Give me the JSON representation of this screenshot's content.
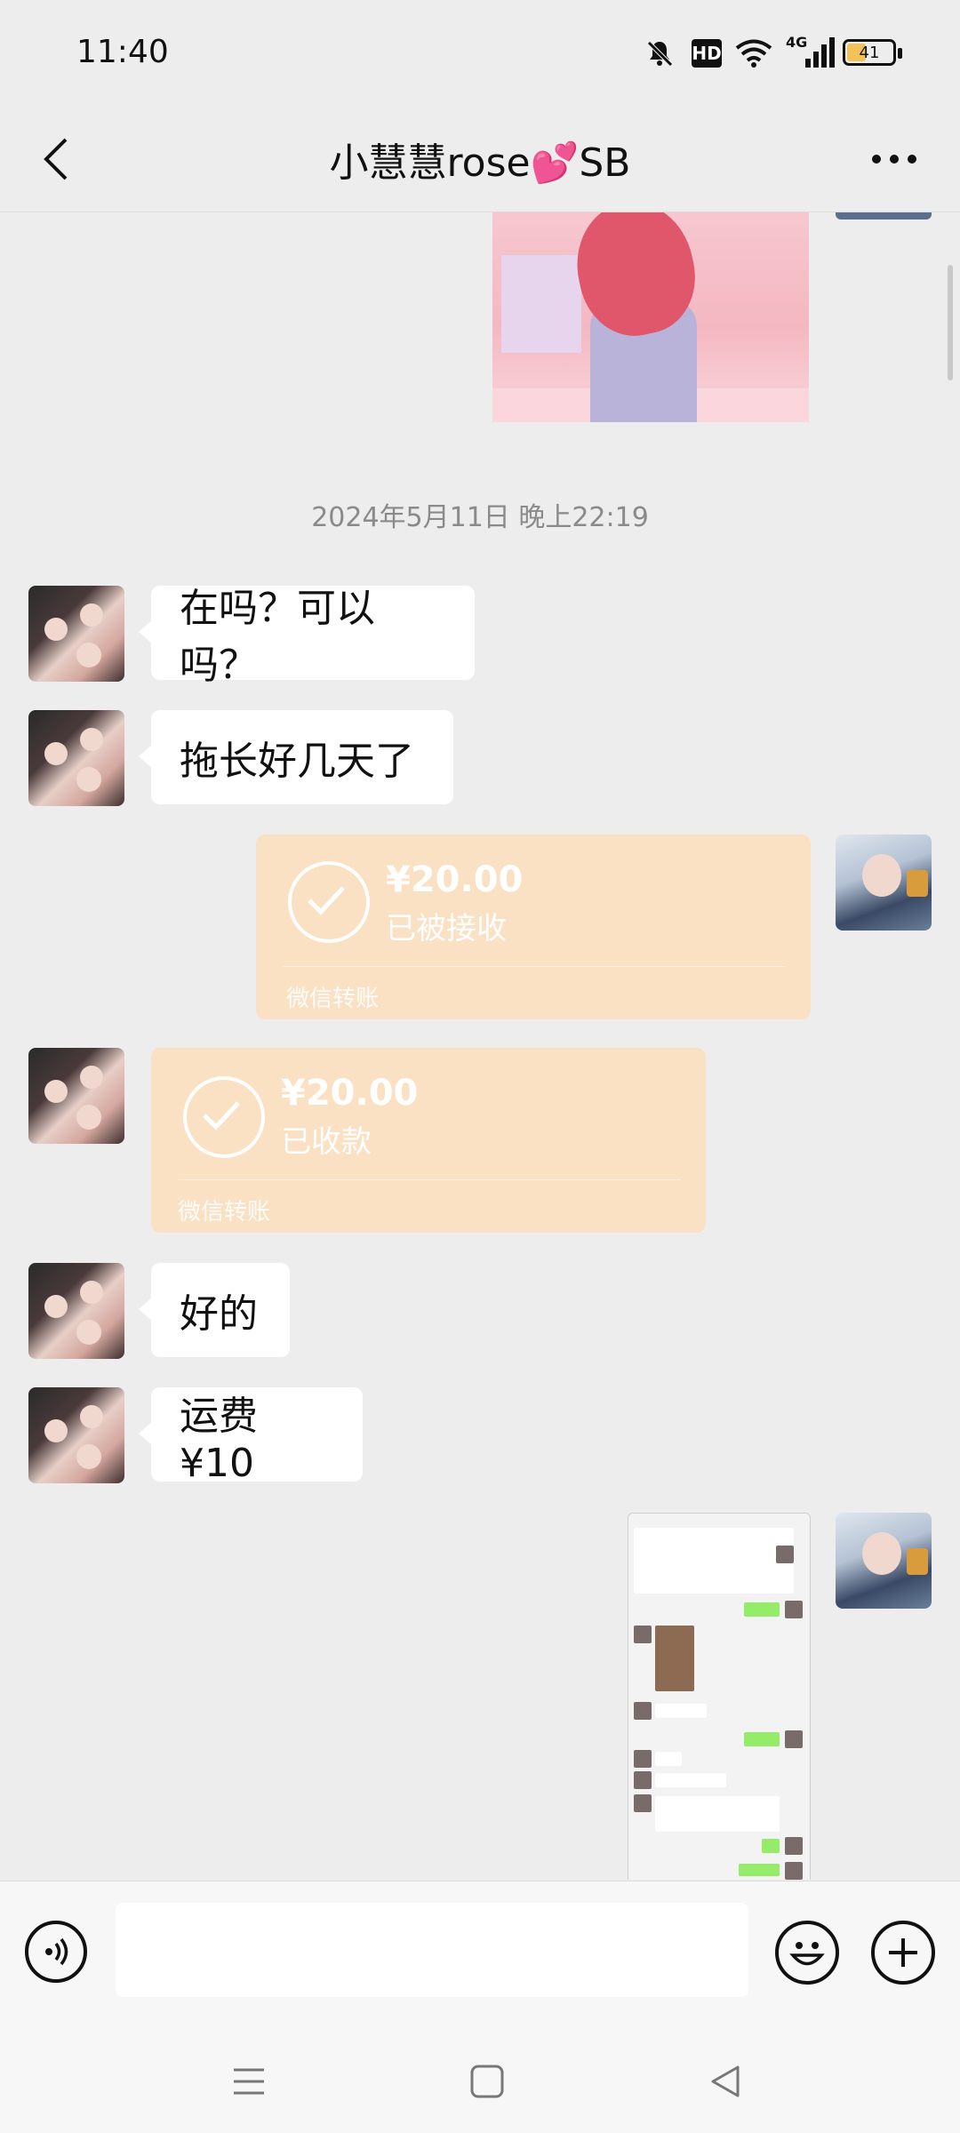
{
  "status_bar": {
    "time": "11:40",
    "battery": "41",
    "battery_level_percent": 41,
    "icons": [
      "mute-icon",
      "hd-icon",
      "wifi-icon",
      "4g-signal-icon",
      "battery-icon"
    ],
    "hd_label": "HD",
    "network_label": "4G"
  },
  "header": {
    "title": "小慧慧rose💕SB",
    "back_icon": "back-chevron-icon",
    "more_icon": "more-dots-icon"
  },
  "chat": {
    "timestamp": "2024年5月11日 晚上22:19",
    "messages": [
      {
        "side": "left",
        "type": "text",
        "text": "在吗？可以吗？"
      },
      {
        "side": "left",
        "type": "text",
        "text": "拖长好几天了"
      },
      {
        "side": "right",
        "type": "transfer",
        "amount": "¥20.00",
        "status": "已被接收",
        "caption": "微信转账"
      },
      {
        "side": "left",
        "type": "transfer",
        "amount": "¥20.00",
        "status": "已收款",
        "caption": "微信转账"
      },
      {
        "side": "left",
        "type": "text",
        "text": "好的"
      },
      {
        "side": "left",
        "type": "text",
        "text": "运费 ¥10"
      }
    ]
  },
  "input_bar": {
    "voice_icon": "voice-icon",
    "emoji_icon": "emoji-icon",
    "plus_icon": "plus-icon",
    "value": ""
  },
  "nav_bar": {
    "icons": [
      "menu-icon",
      "home-square-icon",
      "back-triangle-icon"
    ]
  },
  "colors": {
    "background": "#ededed",
    "bubble_white": "#ffffff",
    "transfer_orange": "#fbe1c4",
    "text": "#111111",
    "timestamp": "#8a8a8a"
  }
}
